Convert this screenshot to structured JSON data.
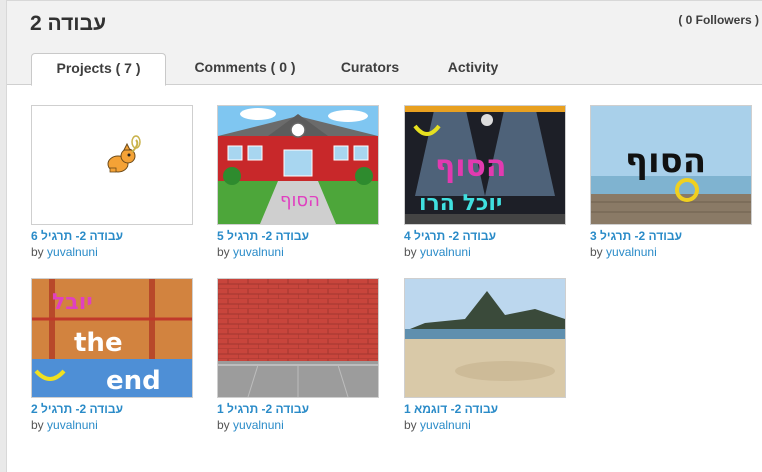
{
  "gallery": {
    "title": "עבודה 2",
    "followers": "( 0 Followers )"
  },
  "tabs": [
    {
      "label": "Projects ( 7 )"
    },
    {
      "label": "Comments ( 0 )"
    },
    {
      "label": "Curators"
    },
    {
      "label": "Activity"
    }
  ],
  "by_prefix": "by",
  "projects": [
    {
      "title": "עבודה 2- תרגיל 6",
      "author": "yuvalnuni"
    },
    {
      "title": "עבודה 2- תרגיל 5",
      "author": "yuvalnuni",
      "thumb_text": "הסוף"
    },
    {
      "title": "עבודה 2- תרגיל 4",
      "author": "yuvalnuni",
      "thumb_text": "הסוף",
      "thumb_text2": "יוכל הרו"
    },
    {
      "title": "עבודה 2- תרגיל 3",
      "author": "yuvalnuni",
      "thumb_text": "הסוף"
    },
    {
      "title": "עבודה 2- תרגיל 2",
      "author": "yuvalnuni",
      "thumb_text": "יובל",
      "thumb_text2": "the",
      "thumb_text3": "end"
    },
    {
      "title": "עבודה 2- תרגיל 1",
      "author": "yuvalnuni"
    },
    {
      "title": "עבודה 2- דוגמא 1",
      "author": "yuvalnuni"
    }
  ]
}
